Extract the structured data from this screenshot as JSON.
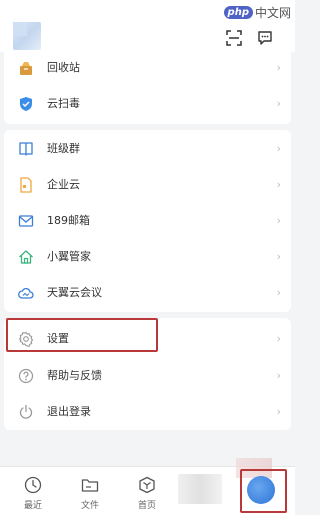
{
  "watermark": {
    "badge": "php",
    "text": "中文网"
  },
  "menu_group1": [
    {
      "name": "recycle-bin",
      "label": "回收站",
      "icon": "trash-bin-icon"
    },
    {
      "name": "cloud-antivirus",
      "label": "云扫毒",
      "icon": "shield-icon"
    }
  ],
  "menu_group2": [
    {
      "name": "class-group",
      "label": "班级群",
      "icon": "book-icon"
    },
    {
      "name": "enterprise-cloud",
      "label": "企业云",
      "icon": "document-icon"
    },
    {
      "name": "189-mail",
      "label": "189邮箱",
      "icon": "mail-icon"
    },
    {
      "name": "smart-home",
      "label": "小翼管家",
      "icon": "home-icon"
    },
    {
      "name": "tianyi-meeting",
      "label": "天翼云会议",
      "icon": "cloud-icon"
    }
  ],
  "menu_group3": [
    {
      "name": "settings",
      "label": "设置",
      "icon": "gear-icon"
    },
    {
      "name": "help-feedback",
      "label": "帮助与反馈",
      "icon": "question-icon"
    },
    {
      "name": "logout",
      "label": "退出登录",
      "icon": "power-icon"
    }
  ],
  "chevron": "›",
  "tabs": [
    {
      "name": "recent",
      "label": "最近",
      "icon": "clock-icon"
    },
    {
      "name": "files",
      "label": "文件",
      "icon": "folder-icon"
    },
    {
      "name": "home",
      "label": "首页",
      "icon": "cube-icon"
    }
  ],
  "colors": {
    "accent_blue": "#2d74d9",
    "highlight_red": "#b9393a",
    "orange": "#f0a641",
    "green": "#39b37b"
  }
}
